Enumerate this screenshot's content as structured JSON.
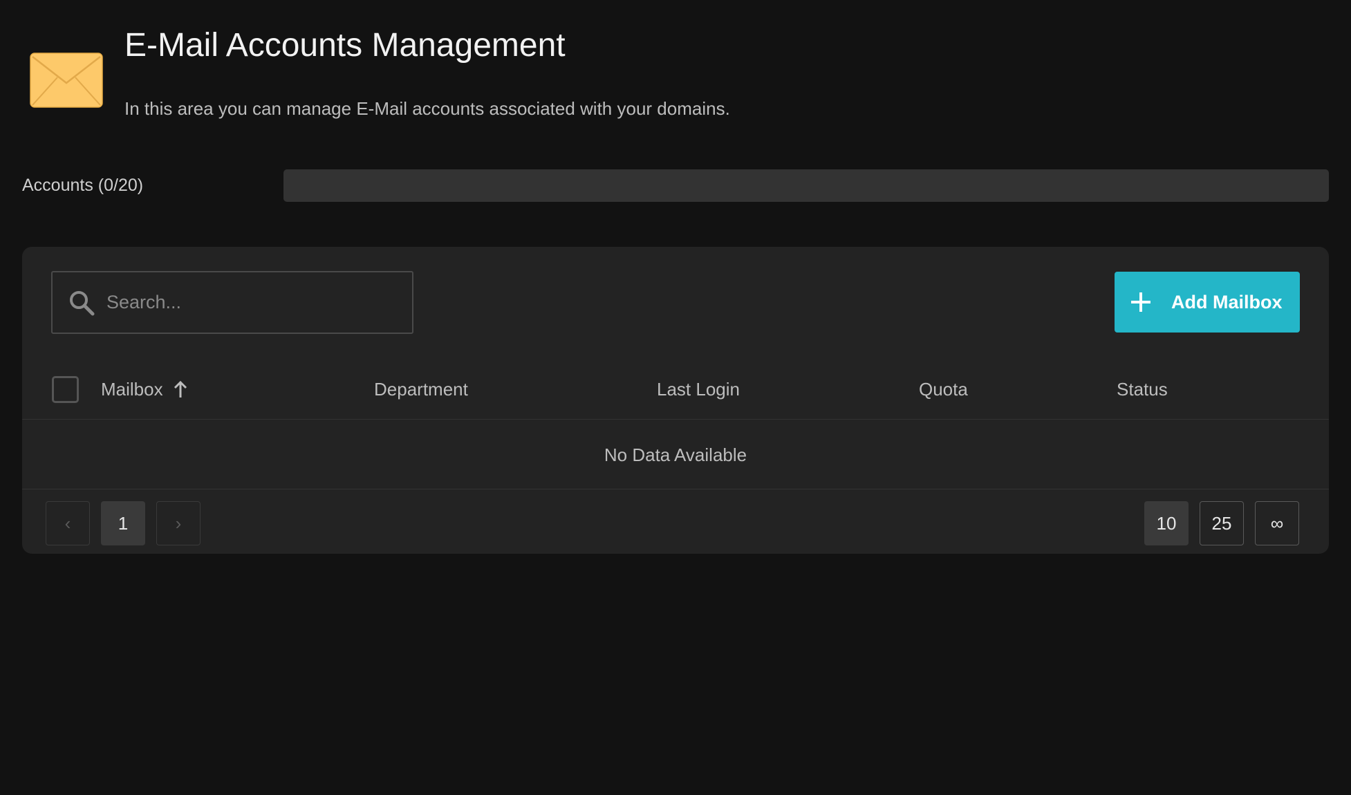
{
  "header": {
    "title": "E-Mail Accounts Management",
    "subtitle": "In this area you can manage E-Mail accounts associated with your domains."
  },
  "quota": {
    "label": "Accounts (0/20)",
    "used": 0,
    "total": 20,
    "fill_fraction": 0
  },
  "toolbar": {
    "search_placeholder": "Search...",
    "search_value": "",
    "add_label": "Add Mailbox"
  },
  "table": {
    "columns": [
      "Mailbox",
      "Department",
      "Last Login",
      "Quota",
      "Status"
    ],
    "sort_column": "Mailbox",
    "sort_direction": "ascending",
    "rows": [],
    "empty_message": "No Data Available"
  },
  "pagination": {
    "prev": "‹",
    "next": "›",
    "pages": [
      "1"
    ],
    "current_page": "1",
    "page_sizes": [
      "10",
      "25",
      "∞"
    ],
    "current_page_size": "10"
  },
  "colors": {
    "background": "#121212",
    "card": "#232323",
    "accent": "#24b6c8",
    "envelope": "#fdc96a"
  },
  "icons": {
    "header": "envelope-icon",
    "search": "search-icon",
    "add": "plus-icon",
    "sort": "arrow-up-icon"
  }
}
